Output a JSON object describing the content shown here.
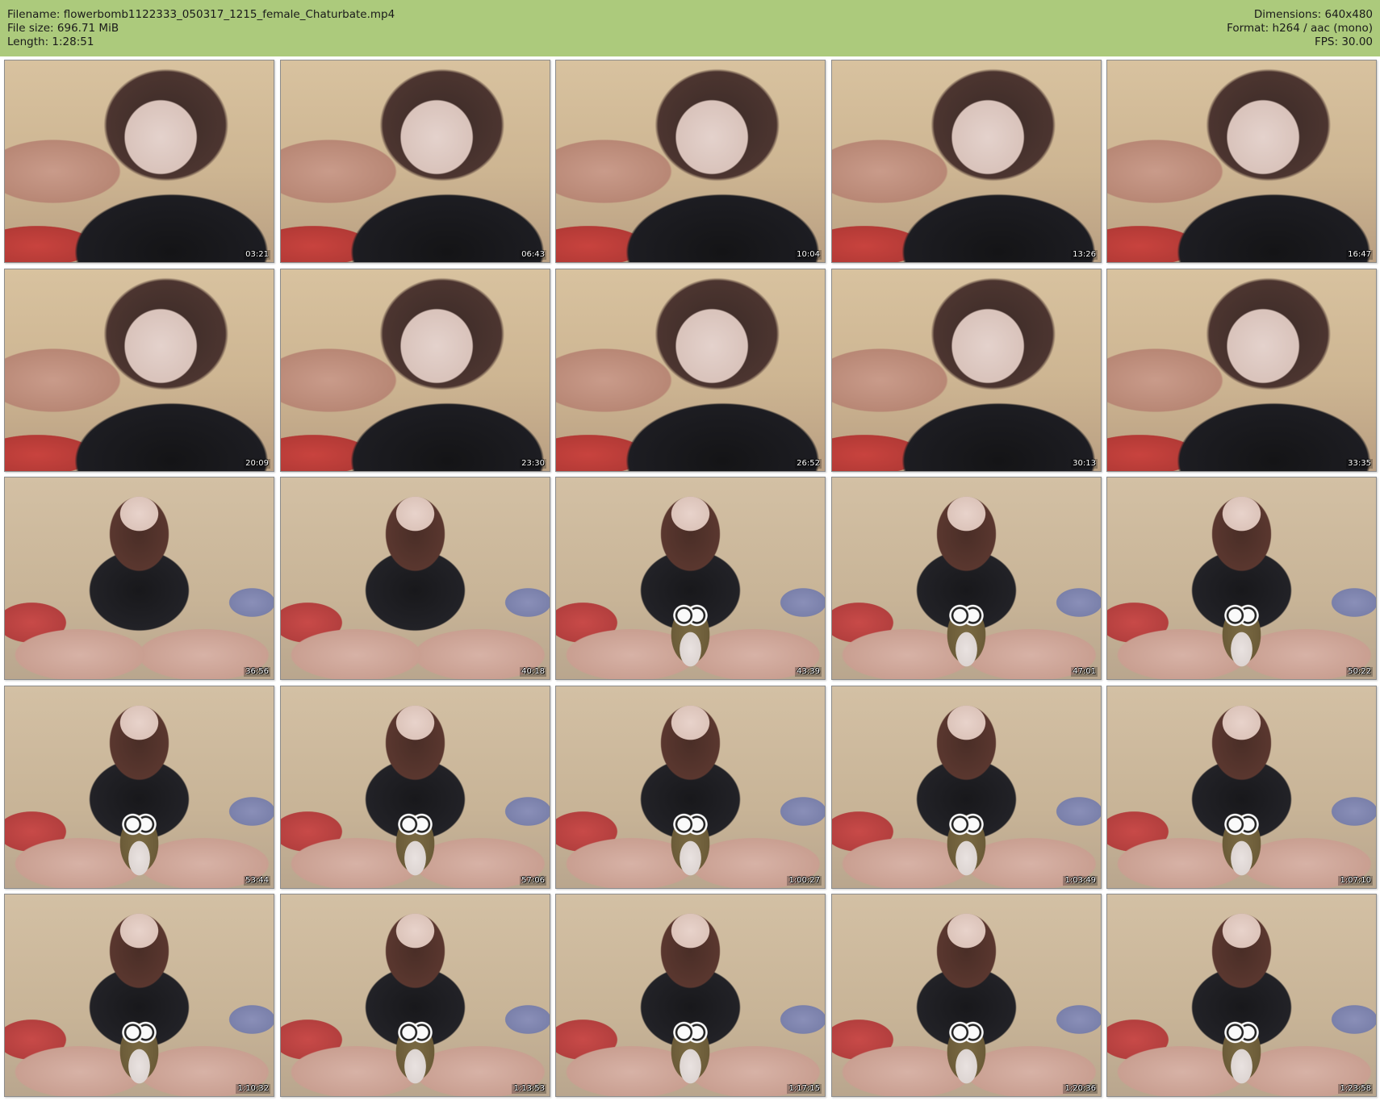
{
  "header": {
    "filename_line": "Filename: flowerbomb1122333_050317_1215_female_Chaturbate.mp4",
    "filesize_line": "File size: 696.71 MiB",
    "length_line": "Length: 1:28:51",
    "dimensions_line": "Dimensions: 640x480",
    "format_line": "Format: h264 / aac (mono)",
    "fps_line": "FPS: 30.00"
  },
  "colors": {
    "header_background": "#acca7c",
    "page_background": "#ffffff"
  },
  "thumbnails": [
    {
      "time": "03:21",
      "scene": "close"
    },
    {
      "time": "06:43",
      "scene": "close"
    },
    {
      "time": "10:04",
      "scene": "close"
    },
    {
      "time": "13:26",
      "scene": "close"
    },
    {
      "time": "16:47",
      "scene": "close"
    },
    {
      "time": "20:09",
      "scene": "close"
    },
    {
      "time": "23:30",
      "scene": "close"
    },
    {
      "time": "26:52",
      "scene": "close"
    },
    {
      "time": "30:13",
      "scene": "close"
    },
    {
      "time": "33:35",
      "scene": "close"
    },
    {
      "time": "36:56",
      "scene": "wide"
    },
    {
      "time": "40:18",
      "scene": "wide"
    },
    {
      "time": "43:39",
      "scene": "wide-owl"
    },
    {
      "time": "47:01",
      "scene": "wide-owl"
    },
    {
      "time": "50:22",
      "scene": "wide-owl"
    },
    {
      "time": "53:44",
      "scene": "wide-owl"
    },
    {
      "time": "57:06",
      "scene": "wide-owl"
    },
    {
      "time": "1:00:27",
      "scene": "wide-owl"
    },
    {
      "time": "1:03:49",
      "scene": "wide-owl"
    },
    {
      "time": "1:07:10",
      "scene": "wide-owl"
    },
    {
      "time": "1:10:32",
      "scene": "wide-owl"
    },
    {
      "time": "1:13:53",
      "scene": "wide-owl"
    },
    {
      "time": "1:17:15",
      "scene": "wide-owl"
    },
    {
      "time": "1:20:36",
      "scene": "wide-owl"
    },
    {
      "time": "1:23:58",
      "scene": "wide-owl"
    }
  ]
}
